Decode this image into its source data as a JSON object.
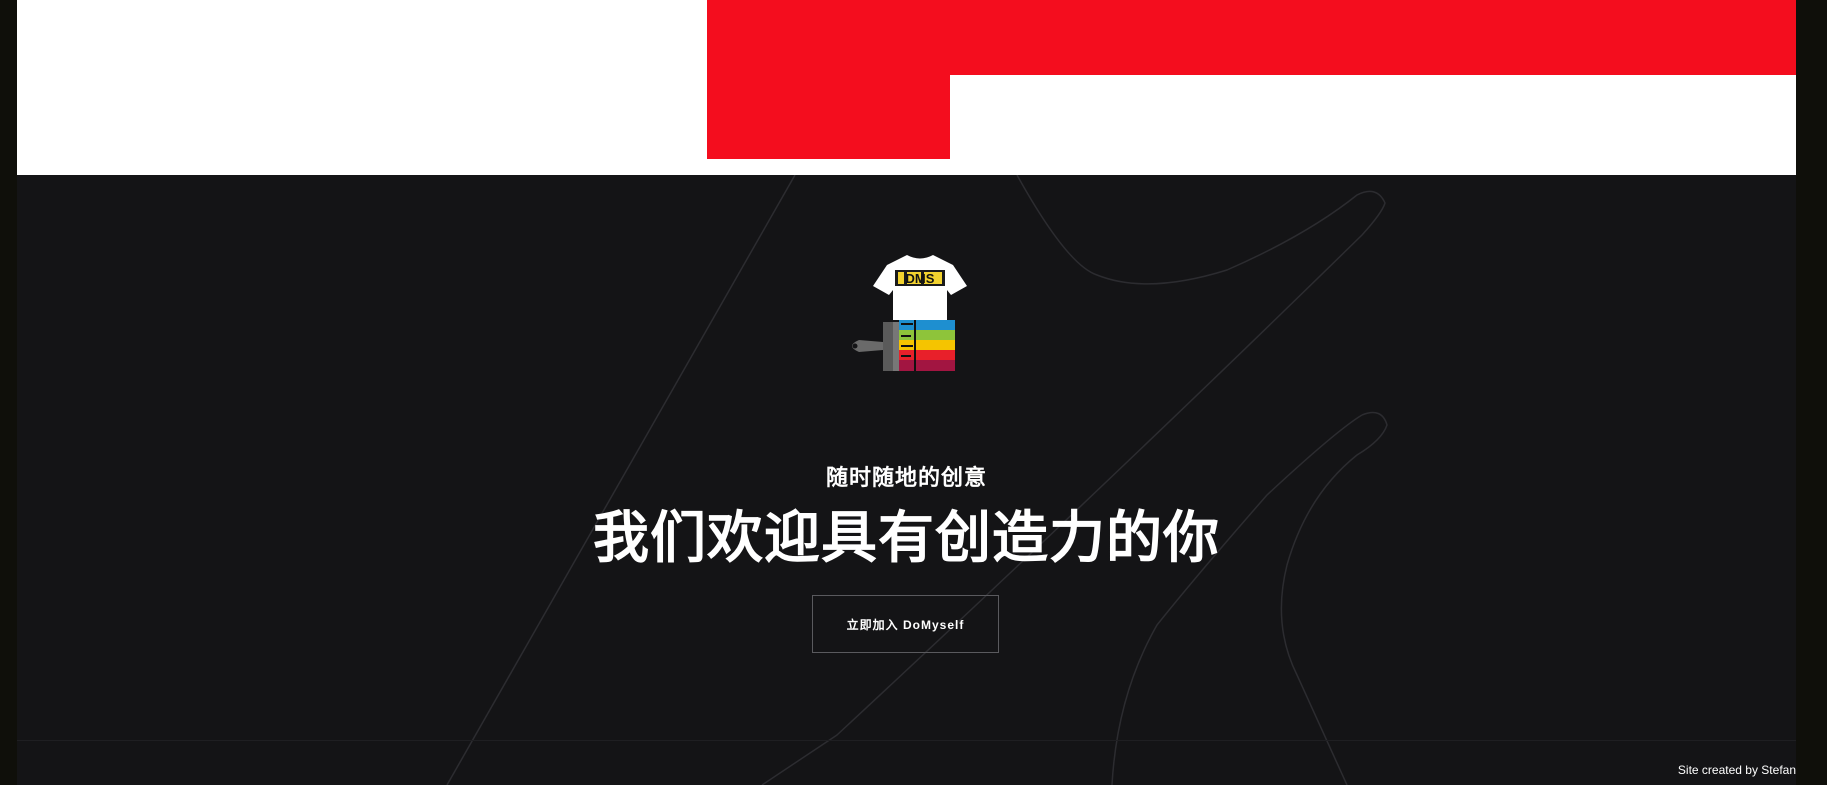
{
  "hero": {
    "eyebrow": "随时随地的创意",
    "headline": "我们欢迎具有创造力的你",
    "cta_label": "立即加入 DoMyself"
  },
  "logo": {
    "shirt_text": "DMS",
    "icon": "tshirt-paintbrush-logo"
  },
  "footer": {
    "credit": "Site created by Stefan"
  },
  "colors": {
    "accent_red": "#f40d1e",
    "hero_bg": "#141416",
    "top_band": "#ffffff"
  }
}
